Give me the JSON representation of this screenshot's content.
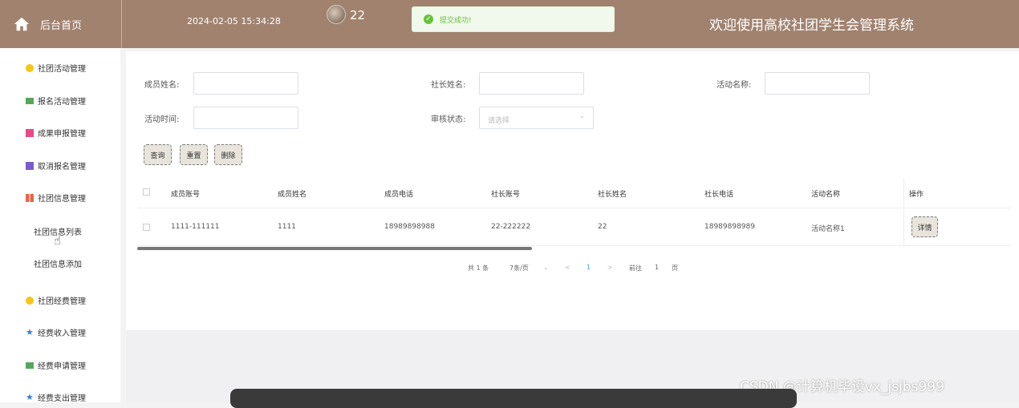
{
  "header": {
    "home_label": "后台首页",
    "datetime": "2024-02-05 15:34:28",
    "user_id": "22",
    "toast_text": "提交成功!",
    "system_title": "欢迎使用高校社团学生会管理系统",
    "bg_color": "#a0826f"
  },
  "sidebar": {
    "items": [
      {
        "label": "社团活动管理",
        "icon": "bulb-icon",
        "color": "#f5c518"
      },
      {
        "label": "报名活动管理",
        "icon": "chat-icon",
        "color": "#58a55c"
      },
      {
        "label": "成果申报管理",
        "icon": "doc-icon",
        "color": "#e84a8a"
      },
      {
        "label": "取消报名管理",
        "icon": "list-icon",
        "color": "#7a5cc8"
      },
      {
        "label": "社团信息管理",
        "icon": "grid-icon",
        "color": "#e8664a"
      },
      {
        "label": "社团经费管理",
        "icon": "bulb-icon",
        "color": "#f5c518"
      },
      {
        "label": "经费收入管理",
        "icon": "star-icon",
        "color": "#3b7fd1"
      },
      {
        "label": "经费申请管理",
        "icon": "chat-icon",
        "color": "#58a55c"
      },
      {
        "label": "经费支出管理",
        "icon": "star-icon",
        "color": "#3b7fd1"
      }
    ],
    "sub_items": [
      "社团信息列表",
      "社团信息添加"
    ]
  },
  "search": {
    "member_name_label": "成员姓名:",
    "leader_name_label": "社长姓名:",
    "activity_name_label": "活动名称:",
    "activity_time_label": "活动时间:",
    "review_status_label": "审核状态:",
    "review_status_placeholder": "请选择",
    "query_btn": "查询",
    "reset_btn": "重置",
    "delete_btn": "删除"
  },
  "table": {
    "headers": [
      "成员账号",
      "成员姓名",
      "成员电话",
      "社长账号",
      "社长姓名",
      "社长电话",
      "活动名称",
      "操作"
    ],
    "rows": [
      {
        "cells": [
          "1111-111111",
          "1111",
          "18989898988",
          "22-222222",
          "22",
          "18989898989",
          "活动名称1"
        ],
        "action": "详情"
      }
    ]
  },
  "pagination": {
    "total": "共 1 条",
    "page_size": "7条/页",
    "prev": "<",
    "current": "1",
    "next": ">",
    "goto_label": "前往",
    "goto_value": "1",
    "page_unit": "页"
  },
  "watermark": "CSDN @计算机毕设vx_jsjbs999"
}
